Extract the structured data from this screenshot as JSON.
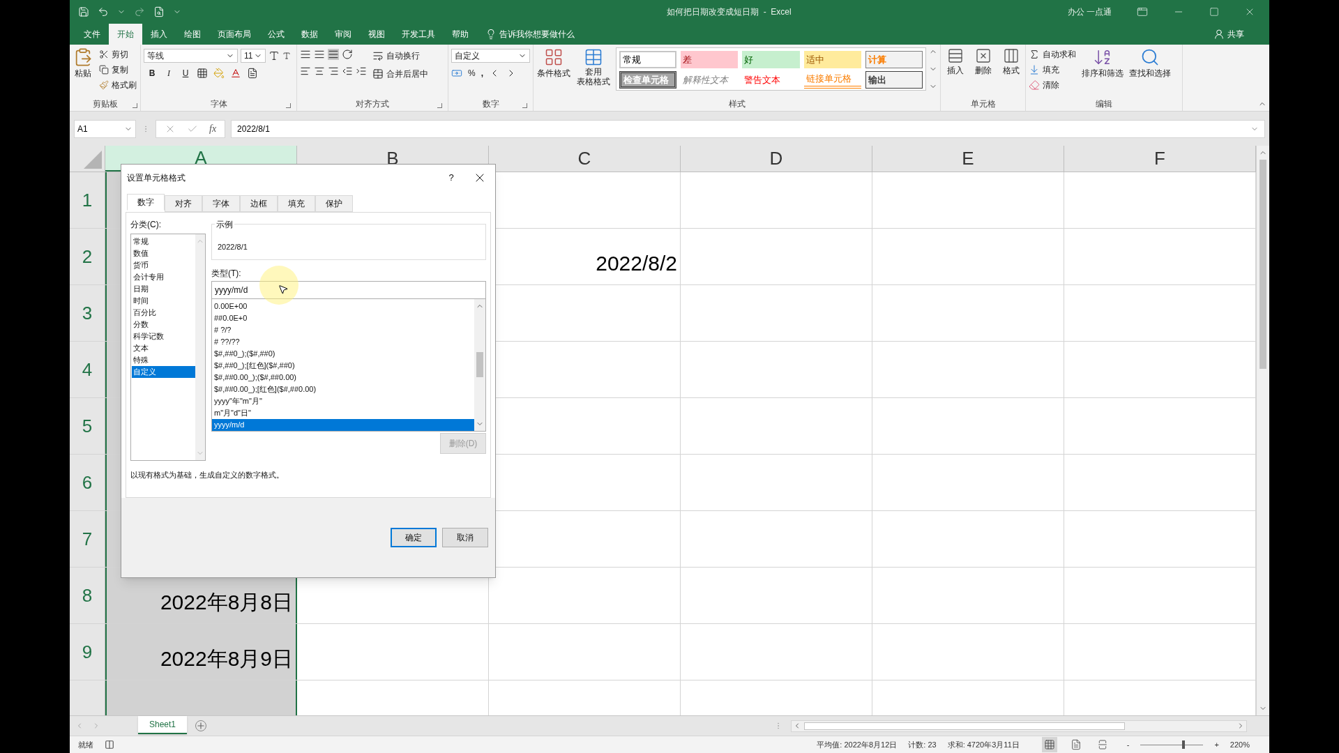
{
  "title_bar": {
    "title": "如何把日期改变成短日期  -  Excel",
    "account": "办公 一点通"
  },
  "menu": {
    "tabs": [
      {
        "label": "文件",
        "selected": false
      },
      {
        "label": "开始",
        "selected": true
      },
      {
        "label": "插入",
        "selected": false
      },
      {
        "label": "绘图",
        "selected": false
      },
      {
        "label": "页面布局",
        "selected": false
      },
      {
        "label": "公式",
        "selected": false
      },
      {
        "label": "数据",
        "selected": false
      },
      {
        "label": "审阅",
        "selected": false
      },
      {
        "label": "视图",
        "selected": false
      },
      {
        "label": "开发工具",
        "selected": false
      },
      {
        "label": "帮助",
        "selected": false
      }
    ],
    "tell_me": "告诉我你想要做什么",
    "share": "共享"
  },
  "ribbon": {
    "clipboard": {
      "label": "剪贴板",
      "paste": "粘贴",
      "cut": "剪切",
      "copy": "复制",
      "format_painter": "格式刷"
    },
    "font": {
      "label": "字体",
      "font_name": "等线",
      "font_size": "11",
      "bold": "B",
      "italic": "I",
      "underline": "U"
    },
    "alignment": {
      "label": "对齐方式",
      "wrap_text": "自动换行",
      "merge_center": "合并后居中"
    },
    "number": {
      "label": "数字",
      "format": "自定义",
      "percent": "%",
      "comma": ","
    },
    "styles": {
      "label": "样式",
      "conditional_formatting": "条件格式",
      "format_as_table": [
        "套用",
        "表格格式"
      ],
      "cell_styles": [
        {
          "label": "常规",
          "kind": "normal"
        },
        {
          "label": "差",
          "kind": "bad"
        },
        {
          "label": "好",
          "kind": "good"
        },
        {
          "label": "适中",
          "kind": "neutral"
        },
        {
          "label": "计算",
          "kind": "calculation"
        },
        {
          "label": "检查单元格",
          "kind": "check"
        },
        {
          "label": "解释性文本",
          "kind": "explanatory"
        },
        {
          "label": "警告文本",
          "kind": "warning"
        },
        {
          "label": "链接单元格",
          "kind": "linked"
        },
        {
          "label": "输出",
          "kind": "output"
        }
      ]
    },
    "cells": {
      "label": "单元格",
      "insert": "插入",
      "delete": "删除",
      "format": "格式"
    },
    "editing": {
      "label": "编辑",
      "autosum": "自动求和",
      "fill": "填充",
      "clear": "清除",
      "sort_filter": "排序和筛选",
      "find_select": "查找和选择"
    }
  },
  "formula_bar": {
    "name_box": "A1",
    "insert_function": "fx",
    "formula": "2022/8/1"
  },
  "sheet": {
    "columns": [
      {
        "label": "A",
        "selected": true
      },
      {
        "label": "B",
        "selected": false
      },
      {
        "label": "C",
        "selected": false
      },
      {
        "label": "D",
        "selected": false
      },
      {
        "label": "E",
        "selected": false
      },
      {
        "label": "F",
        "selected": false
      }
    ],
    "rows": [
      {
        "number": "1",
        "cells": [
          {},
          {},
          {},
          {},
          {},
          {}
        ]
      },
      {
        "number": "2",
        "cells": [
          {},
          {},
          {
            "text": "2022/8/2"
          },
          {},
          {},
          {}
        ]
      },
      {
        "number": "3",
        "cells": [
          {},
          {},
          {},
          {},
          {},
          {}
        ]
      },
      {
        "number": "4",
        "cells": [
          {},
          {},
          {},
          {},
          {},
          {}
        ]
      },
      {
        "number": "5",
        "cells": [
          {},
          {},
          {},
          {},
          {},
          {}
        ]
      },
      {
        "number": "6",
        "cells": [
          {},
          {},
          {},
          {},
          {},
          {}
        ]
      },
      {
        "number": "7",
        "cells": [
          {},
          {},
          {},
          {},
          {},
          {}
        ]
      },
      {
        "number": "8",
        "cells": [
          {
            "text": "2022年8月8日"
          },
          {},
          {},
          {},
          {},
          {}
        ]
      },
      {
        "number": "9",
        "cells": [
          {
            "text": "2022年8月9日"
          },
          {},
          {},
          {},
          {},
          {}
        ]
      }
    ]
  },
  "dialog": {
    "title": "设置单元格格式",
    "help": "?",
    "tabs": [
      {
        "label": "数字",
        "selected": true
      },
      {
        "label": "对齐",
        "selected": false
      },
      {
        "label": "字体",
        "selected": false
      },
      {
        "label": "边框",
        "selected": false
      },
      {
        "label": "填充",
        "selected": false
      },
      {
        "label": "保护",
        "selected": false
      }
    ],
    "category_label": "分类(C):",
    "categories": [
      {
        "label": "常规",
        "selected": false
      },
      {
        "label": "数值",
        "selected": false
      },
      {
        "label": "货币",
        "selected": false
      },
      {
        "label": "会计专用",
        "selected": false
      },
      {
        "label": "日期",
        "selected": false
      },
      {
        "label": "时间",
        "selected": false
      },
      {
        "label": "百分比",
        "selected": false
      },
      {
        "label": "分数",
        "selected": false
      },
      {
        "label": "科学记数",
        "selected": false
      },
      {
        "label": "文本",
        "selected": false
      },
      {
        "label": "特殊",
        "selected": false
      },
      {
        "label": "自定义",
        "selected": true
      }
    ],
    "sample_label": "示例",
    "sample": "2022/8/1",
    "type_label": "类型(T):",
    "type_value": "yyyy/m/d",
    "formats": [
      {
        "label": "0.00E+00",
        "selected": false
      },
      {
        "label": "##0.0E+0",
        "selected": false
      },
      {
        "label": "# ?/?",
        "selected": false
      },
      {
        "label": "# ??/??",
        "selected": false
      },
      {
        "label": "$#,##0_);($#,##0)",
        "selected": false
      },
      {
        "label": "$#,##0_);[红色]($#,##0)",
        "selected": false
      },
      {
        "label": "$#,##0.00_);($#,##0.00)",
        "selected": false
      },
      {
        "label": "$#,##0.00_);[红色]($#,##0.00)",
        "selected": false
      },
      {
        "label": "yyyy\"年\"m\"月\"",
        "selected": false
      },
      {
        "label": "m\"月\"d\"日\"",
        "selected": false
      },
      {
        "label": "yyyy/m/d",
        "selected": true
      }
    ],
    "delete_button": {
      "label": "删除(D)",
      "disabled": true
    },
    "description": "以现有格式为基础，生成自定义的数字格式。",
    "ok": "确定",
    "cancel": "取消"
  },
  "sheet_tabs": [
    {
      "label": "Sheet1",
      "selected": true
    }
  ],
  "status_bar": {
    "ready": "就绪",
    "average": "平均值: 2022年8月12日",
    "count": "计数: 23",
    "sum": "求和: 4720年3月11日",
    "zoom_out": "-",
    "zoom_in": "+",
    "zoom": {
      "level": 0.68,
      "reading": "220%"
    }
  }
}
